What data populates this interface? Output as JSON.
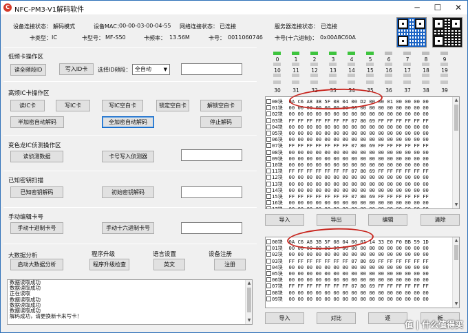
{
  "window": {
    "title": "NFC-PM3-V1解码软件",
    "app_icon": "C",
    "controls": {
      "minimize": "─",
      "maximize": "☐",
      "close": "✕"
    }
  },
  "status": {
    "conn_label": "设备连接状态：",
    "conn_value": "解码模式",
    "mac_label": "设备MAC：",
    "mac_value": "00-00-03-00-04-55",
    "net_label": "网络连接状态：",
    "net_value": "已连接",
    "server_label": "服务器连接状态：",
    "server_value": "已连接",
    "cardtype_label": "卡类型：",
    "cardtype_value": "IC",
    "model_label": "卡型号：",
    "model_value": "MF-S50",
    "freq_label": "卡频率：",
    "freq_value": "13.56M",
    "cardno_label": "卡号：",
    "cardno_value": "0011060746",
    "cardhex_label": "卡号(十六进制)：",
    "cardhex_value": "0x00A8C60A"
  },
  "lf": {
    "title": "低频卡操作区",
    "read_btn": "读全频段ID",
    "write_btn": "写入ID卡",
    "freq_label": "选择ID频段：",
    "freq_value": "全自动",
    "id_value": ""
  },
  "hf": {
    "title": "高频IC卡操作区",
    "read_btn": "读IC卡",
    "write_btn": "写IC卡",
    "write_blank_btn": "写IC空白卡",
    "lock_btn": "锁定空白卡",
    "unlock_btn": "解锁空白卡",
    "semi_btn": "半加密自动解码",
    "full_btn": "全加密自动解码",
    "stop_btn": "停止解码"
  },
  "chameleon": {
    "title": "变色龙IC侦测操作区",
    "read_btn": "读侦测数据",
    "write_btn": "卡号写入侦测器",
    "value": ""
  },
  "known": {
    "title": "已知密钥扫描",
    "decode_btn": "已知密钥解码",
    "init_btn": "初始密钥解码",
    "value": ""
  },
  "manual": {
    "title": "手动编辑卡号",
    "dec_btn": "手动十进制卡号",
    "hex_btn": "手动十六进制卡号",
    "value": ""
  },
  "bigdata": {
    "title": "大数据分析",
    "btn": "启动大数据分析"
  },
  "upgrade": {
    "title": "程序升级",
    "btn": "程序升级检查"
  },
  "lang": {
    "title": "语言设置",
    "btn": "英文"
  },
  "register": {
    "title": "设备注册",
    "btn": "注册"
  },
  "log": [
    "数据读取成功",
    "数据读取成功",
    "正在读取",
    "数据读取成功",
    "数据读取成功",
    "数据读取成功",
    "解码成功，请更换新卡来写卡！"
  ],
  "sectors": {
    "labels_top": [
      "0",
      "1",
      "2",
      "3",
      "4",
      "5",
      "6",
      "7",
      "8",
      "9"
    ],
    "row1_state": [
      "on",
      "on",
      "on",
      "on",
      "on",
      "on",
      "off",
      "off",
      "off",
      "off"
    ],
    "labels_mid": [
      "10",
      "11",
      "12",
      "13",
      "14",
      "15",
      "16",
      "17",
      "18",
      "19"
    ],
    "row2_state": [
      "gray",
      "gray",
      "gray",
      "gray",
      "gray",
      "gray",
      "gray",
      "gray",
      "gray",
      "gray"
    ],
    "labels_bottom": [
      "30",
      "31",
      "32",
      "33",
      "34",
      "35",
      "36",
      "37",
      "38",
      "39"
    ],
    "on_color": "#3ec43e",
    "off_color": "#bdbdbd"
  },
  "dump1": {
    "rows": [
      {
        "id": "00",
        "bytes": "0A C6 A8 3B 5F 08 04 00 D2 00 00 01 00 00 00 00"
      },
      {
        "id": "01",
        "bytes": "00 00 00 00 00 00 00 00 00 00 00 00 00 00 00 00"
      },
      {
        "id": "02",
        "bytes": "00 00 00 00 00 00 00 00 00 00 00 00 00 00 00 00"
      },
      {
        "id": "03",
        "bytes": "FF FF FF FF FF FF FF 07 80 69 FF FF FF FF FF FF"
      },
      {
        "id": "04",
        "bytes": "00 00 00 00 00 00 00 00 00 00 00 00 00 00 00 00"
      },
      {
        "id": "05",
        "bytes": "00 00 00 00 00 00 00 00 00 00 00 00 00 00 00 00"
      },
      {
        "id": "06",
        "bytes": "00 00 00 00 00 00 00 00 00 00 00 00 00 00 00 00"
      },
      {
        "id": "07",
        "bytes": "FF FF FF FF FF FF FF 07 80 69 FF FF FF FF FF FF"
      },
      {
        "id": "08",
        "bytes": "00 00 00 00 00 00 00 00 00 00 00 00 00 00 00 00"
      },
      {
        "id": "09",
        "bytes": "00 00 00 00 00 00 00 00 00 00 00 00 00 00 00 00"
      },
      {
        "id": "10",
        "bytes": "00 00 00 00 00 00 00 00 00 00 00 00 00 00 00 00"
      },
      {
        "id": "11",
        "bytes": "FF FF FF FF FF FF FF 07 80 69 FF FF FF FF FF FF"
      },
      {
        "id": "12",
        "bytes": "00 00 00 00 00 00 00 00 00 00 00 00 00 00 00 00"
      },
      {
        "id": "13",
        "bytes": "00 00 00 00 00 00 00 00 00 00 00 00 00 00 00 00"
      },
      {
        "id": "14",
        "bytes": "00 00 00 00 00 00 00 00 00 00 00 00 00 00 00 00"
      },
      {
        "id": "15",
        "bytes": "FF FF FF FF FF FF FF 07 80 69 FF FF FF FF FF FF"
      },
      {
        "id": "16",
        "bytes": "00 00 00 00 00 00 00 00 00 00 00 00 00 00 00 00"
      },
      {
        "id": "17",
        "bytes": "00 00 00 00 00 00 00 00 00 00 00 00 00 00 00 00"
      }
    ],
    "buttons": [
      "导入",
      "导出",
      "编辑",
      "清除"
    ]
  },
  "dump2": {
    "rows": [
      {
        "id": "00",
        "bytes": "0A C6 A8 3B 5F 08 04 00 01 14 33 E0 F0 BB 59 1D"
      },
      {
        "id": "01",
        "bytes": "00 00 00 00 00 00 00 00 00 00 00 00 00 00 00 00"
      },
      {
        "id": "02",
        "bytes": "00 00 00 00 00 00 00 00 00 00 00 00 00 00 00 00"
      },
      {
        "id": "03",
        "bytes": "FF FF FF FF FF FF FF 07 80 69 FF FF FF FF FF FF"
      },
      {
        "id": "04",
        "bytes": "00 00 00 00 00 00 00 00 00 00 00 00 00 00 00 00"
      },
      {
        "id": "05",
        "bytes": "00 00 00 00 00 00 00 00 00 00 00 00 00 00 00 00"
      },
      {
        "id": "06",
        "bytes": "00 00 00 00 00 00 00 00 00 00 00 00 00 00 00 00"
      },
      {
        "id": "07",
        "bytes": "FF FF FF FF FF FF FF 07 80 69 FF FF FF FF FF FF"
      },
      {
        "id": "08",
        "bytes": "00 00 00 00 00 00 00 00 00 00 00 00 00 00 00 00"
      },
      {
        "id": "09",
        "bytes": "00 00 00 00 00 00 00 00 00 00 00 00 00 00 00 00"
      }
    ],
    "block_suffix": "块",
    "buttons": [
      "导入",
      "对比",
      "逐",
      "新"
    ]
  },
  "watermark": "值 | 什么值得买",
  "accent": "#c8261f"
}
